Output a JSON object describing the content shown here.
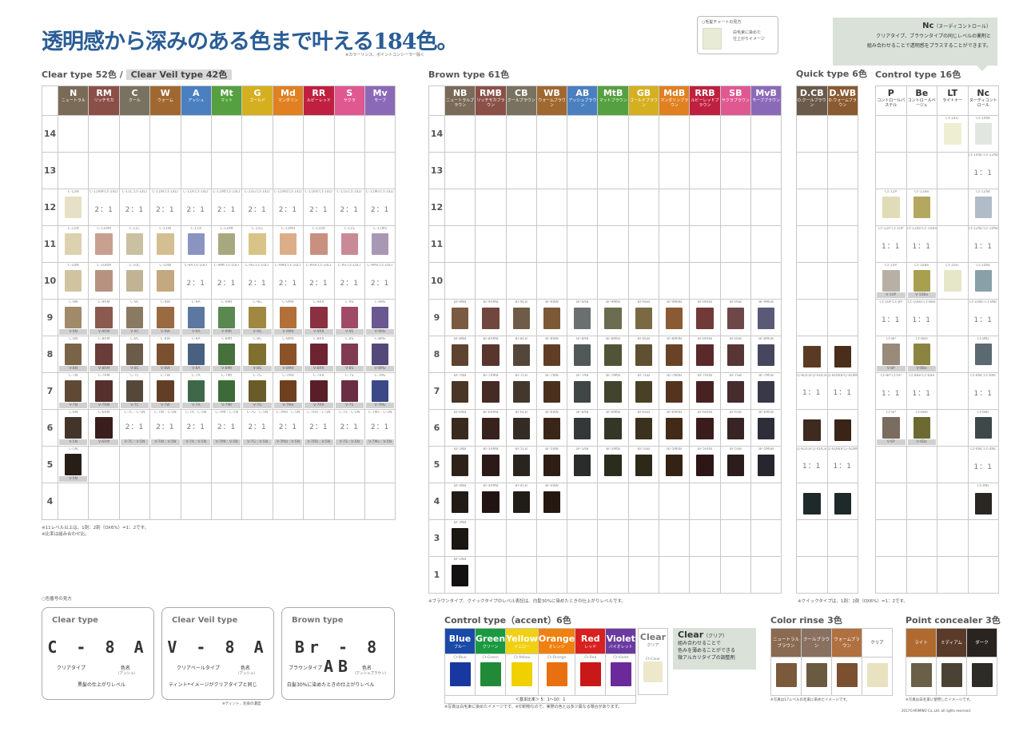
{
  "title": "透明感から深みのある色まで叶える184色。",
  "title_note": "※カラーリンス、ポイントコンシーラー除く",
  "guide": {
    "title": "○毛髪チャートの見方",
    "desc1": "白毛束に染めた",
    "desc2": "仕上がりイメージ"
  },
  "nc_note": {
    "title": "Nc",
    "sub": "（ヌーディコントロール）",
    "line1": "クリアタイプ、ブラウンタイプの同じレベルの薬剤と",
    "line2": "組み合わせることで透明感をプラスすることができます。"
  },
  "clear": {
    "title": "Clear type 52色 /",
    "veil": "Clear Veil type 42色",
    "cols": [
      {
        "n": "N",
        "s": "ニュートラル",
        "c": "#7a6a58"
      },
      {
        "n": "RM",
        "s": "リッチモカ",
        "c": "#8a5048"
      },
      {
        "n": "C",
        "s": "クール",
        "c": "#7a7260"
      },
      {
        "n": "W",
        "s": "ウォーム",
        "c": "#a06830"
      },
      {
        "n": "A",
        "s": "アッシュ",
        "c": "#4a80c0"
      },
      {
        "n": "Mt",
        "s": "マット",
        "c": "#55a040"
      },
      {
        "n": "G",
        "s": "ゴールド",
        "c": "#d4b020"
      },
      {
        "n": "Md",
        "s": "マンダリン",
        "c": "#e08020"
      },
      {
        "n": "RR",
        "s": "ルビーレッド",
        "c": "#c02040"
      },
      {
        "n": "S",
        "s": "サクラ",
        "c": "#e05890"
      },
      {
        "n": "Mv",
        "s": "モーブ",
        "c": "#8a6ab8"
      }
    ],
    "levels": [
      "14",
      "13",
      "12",
      "11",
      "10",
      "9",
      "8",
      "7",
      "6",
      "5",
      "4"
    ],
    "r12": {
      "c": [
        "C-12N",
        "C-11RM:Ct-14LT",
        "C-11C:Ct-14LT",
        "C-11W:Ct-14LT",
        "C-11A:Ct-14LT",
        "C-11Mt:Ct-14LT",
        "C-11G:Ct-14LT",
        "C-11Md:Ct-14LT",
        "C-11RR:Ct-14LT",
        "C-11S:Ct-14LT",
        "C-11Mv:Ct-14LT"
      ],
      "r": "2：1",
      "sw": [
        "#e6e0c6"
      ]
    },
    "r11": {
      "c": [
        "C-11N",
        "C-11RM",
        "C-11C",
        "C-11W",
        "C-11A",
        "C-11Mt",
        "C-11G",
        "C-11Md",
        "C-11RR",
        "C-11S",
        "C-11Mv"
      ],
      "sw": [
        "#dcd2b0",
        "#c8a090",
        "#cac0a2",
        "#d4bf92",
        "#8a94c0",
        "#a8a880",
        "#d8c488",
        "#dcae88",
        "#c89080",
        "#c88a96",
        "#a898b4"
      ]
    },
    "r10": {
      "c": [
        "C-10N",
        "C-10RM",
        "C-10C",
        "C-10W",
        "C-9A:Ct-10LT",
        "C-9Mt:Ct-10LT",
        "C-9G:Ct-10LT",
        "C-9Md:Ct-10LT",
        "C-9RR:Ct-10LT",
        "C-9S:Ct-10LT",
        "C-9Mv:Ct-10LT"
      ],
      "r": "2：1",
      "sw": [
        "#d0c4a0",
        "#b89280",
        "#c0b494",
        "#c4a880"
      ]
    },
    "r9": {
      "c": [
        "C-9N",
        "C-9RM",
        "C-9C",
        "C-9W",
        "C-9A",
        "C-9Mt",
        "C-9G",
        "C-9Md",
        "C-9RR",
        "C-9S",
        "C-9Mv"
      ],
      "v": [
        "V-9N",
        "V-9RM",
        "V-9C",
        "V-9W",
        "V-9A",
        "V-9Mt",
        "V-9G",
        "V-9Md",
        "V-9RR",
        "V-9S",
        "V-9Mv"
      ],
      "sw": [
        "#a08a6a",
        "#8a5a50",
        "#8a7a62",
        "#9a6a40",
        "#5c78a0",
        "#5a8850",
        "#a08840",
        "#b07038",
        "#8a3040",
        "#a04a68",
        "#6a5890"
      ]
    },
    "r8": {
      "c": [
        "C-8N",
        "C-8RM",
        "C-8C",
        "C-8W",
        "C-8A",
        "C-8Mt",
        "C-8G",
        "C-8Md",
        "C-8RR",
        "C-8S",
        "C-8Mv"
      ],
      "v": [
        "V-8N",
        "V-8RM",
        "V-8C",
        "V-8W",
        "V-8A",
        "V-8Mt",
        "V-8G",
        "V-8Md",
        "V-8RR",
        "V-8S",
        "V-8Mv"
      ],
      "sw": [
        "#7a6448",
        "#6a3c38",
        "#6a5c48",
        "#7a5030",
        "#4a6080",
        "#46703c",
        "#807030",
        "#8a5228",
        "#6e2430",
        "#803a52",
        "#544878"
      ]
    },
    "r7": {
      "c": [
        "C-7N",
        "C-7RM",
        "C-7C",
        "C-7W",
        "C-7A",
        "C-7Mt",
        "C-7G",
        "C-7Md",
        "C-7RR",
        "C-7S",
        "C-7Mv"
      ],
      "v": [
        "V-7N",
        "V-7RM",
        "V-7C",
        "V-7W",
        "V-7A",
        "V-7Mt",
        "V-7G",
        "V-7Md",
        "V-7RR",
        "V-7S",
        "V-7Mv"
      ],
      "sw": [
        "#5e4a34",
        "#55302c",
        "#54483a",
        "#623e26",
        "#3e6848",
        "#3c6a38",
        "#6a5c28",
        "#6e4020",
        "#5a1e28",
        "#6a2e44",
        "#3c4888"
      ]
    },
    "r6": {
      "c": [
        "C-6N",
        "C-6RM",
        "C-7C : C-5N",
        "C-7W : C-5N",
        "C-7A : C-5N",
        "C-7Mt : C-5N",
        "C-7G : C-5N",
        "C-7Md : C-5N",
        "C-7RR : C-5N",
        "C-7S : C-5N",
        "C-7Mv : C-5N"
      ],
      "v": [
        "V-5N",
        "V-6RM",
        "V-7C : V-5N",
        "V-7W : V-5N",
        "V-7A : V-5N",
        "V-7Mt : V-5N",
        "V-7G : V-5N",
        "V-7Md : V-5N",
        "V-7RR : V-5N",
        "V-7S : V-5N",
        "V-7Mv : V-5N"
      ],
      "r": "2：1",
      "sw": [
        "#423428",
        "#3a1e1e"
      ]
    },
    "r5": {
      "c": "C-5N",
      "v": "V-5N",
      "sw": "#281e18"
    },
    "note1": "※11レベル以上は、1剤：2剤（OX6%）=1：2です。",
    "note2": "※比率は組み合わせ比。"
  },
  "brown": {
    "title": "Brown type 61色",
    "cols": [
      {
        "n": "NB",
        "s": "ニュートラルブラウン",
        "c": "#7a6a58"
      },
      {
        "n": "RMB",
        "s": "リッチモカブラウン",
        "c": "#8a5048"
      },
      {
        "n": "CB",
        "s": "クールブラウン",
        "c": "#7a7260"
      },
      {
        "n": "WB",
        "s": "ウォームブラウン",
        "c": "#a06830"
      },
      {
        "n": "AB",
        "s": "アッシュブラウン",
        "c": "#4a80c0"
      },
      {
        "n": "MtB",
        "s": "マットブラウン",
        "c": "#55a040"
      },
      {
        "n": "GB",
        "s": "ゴールドブラウン",
        "c": "#d4b020"
      },
      {
        "n": "MdB",
        "s": "マンダリンブラウン",
        "c": "#e08020"
      },
      {
        "n": "RRB",
        "s": "ルビーレッドブラウン",
        "c": "#c02040"
      },
      {
        "n": "SB",
        "s": "サクラブラウン",
        "c": "#e05890"
      },
      {
        "n": "MvB",
        "s": "モーブブラウン",
        "c": "#8a6ab8"
      }
    ],
    "levels": [
      "14",
      "13",
      "12",
      "11",
      "10",
      "9",
      "8",
      "7",
      "6",
      "5",
      "4",
      "3",
      "1"
    ],
    "r9": {
      "c": [
        "Br-9NB",
        "Br-9RMB",
        "Br-9CB",
        "Br-9WB",
        "Br-9AB",
        "Br-9MtB",
        "Br-9GB",
        "Br-9MdB",
        "Br-9RRB",
        "Br-9SB",
        "Br-9MvB"
      ],
      "sw": [
        "#7a5a40",
        "#70473e",
        "#6e5c48",
        "#7c5836",
        "#6a7070",
        "#6c6c50",
        "#7a6a44",
        "#8a5a34",
        "#703a38",
        "#6e4848",
        "#5a5a78"
      ]
    },
    "r8": {
      "c": [
        "Br-8NB",
        "Br-8RMB",
        "Br-8CB",
        "Br-8WB",
        "Br-8AB",
        "Br-8MtB",
        "Br-8GB",
        "Br-8MdB",
        "Br-8RRB",
        "Br-8SB",
        "Br-8MvB"
      ],
      "sw": [
        "#5e4430",
        "#58362e",
        "#54463a",
        "#603e26",
        "#505858",
        "#525438",
        "#5e5030",
        "#6a4226",
        "#5a2a2a",
        "#583636",
        "#46465e"
      ]
    },
    "r7": {
      "c": [
        "Br-7NB",
        "Br-7RMB",
        "Br-7CB",
        "Br-7WB",
        "Br-7AB",
        "Br-7MtB",
        "Br-7GB",
        "Br-7MdB",
        "Br-7RRB",
        "Br-7SB",
        "Br-7MvB"
      ],
      "sw": [
        "#4a3626",
        "#462a24",
        "#42382e",
        "#4c301e",
        "#404646",
        "#42442e",
        "#4a4026",
        "#54341e",
        "#482222",
        "#462c2c",
        "#383848"
      ]
    },
    "r6": {
      "c": [
        "Br-6NB",
        "Br-6RMB",
        "Br-6CB",
        "Br-6WB",
        "Br-6AB",
        "Br-6MtB",
        "Br-6GB",
        "Br-6MdB",
        "Br-6RRB",
        "Br-6SB",
        "Br-6MvB"
      ],
      "sw": [
        "#3a2a1e",
        "#38221e",
        "#342c24",
        "#3a2618",
        "#343838",
        "#343626",
        "#3a321e",
        "#422a18",
        "#3a1c1c",
        "#382424",
        "#2e2e3a"
      ]
    },
    "r5": {
      "c": [
        "Br-5NB",
        "Br-5RMB",
        "Br-5CB",
        "Br-5WB",
        "Br-5AB",
        "Br-5MtB",
        "Br-5GB",
        "Br-5MdB",
        "Br-5RRB",
        "Br-5SB",
        "Br-5MvB"
      ],
      "sw": [
        "#2e2218",
        "#2c1a18",
        "#2a241e",
        "#2e1e14",
        "#2a2c2c",
        "#2a2c1e",
        "#2e2818",
        "#342214",
        "#2e1616",
        "#2c1c1c",
        "#26262e"
      ]
    },
    "r4": {
      "c": [
        "Br-4NB",
        "Br-4RMB",
        "Br-4CB",
        "Br-4WB"
      ],
      "sw": [
        "#221a14",
        "#221412",
        "#201c18",
        "#241810"
      ]
    },
    "r3": {
      "c": "Br-3NB",
      "sw": "#1a1612"
    },
    "r1": {
      "c": "Br-1NB",
      "sw": "#121010"
    },
    "note": "※ブラウンタイプ、クイックタイプのレベル表記は、白髪30%に染めたときの仕上がりレベルです。"
  },
  "quick": {
    "title": "Quick type 6色",
    "cols": [
      {
        "n": "D.CB",
        "s": "D.クールブラウン",
        "c": "#6a5a4a"
      },
      {
        "n": "D.WB",
        "s": "D.ウォームブラウン",
        "c": "#8a5a30"
      }
    ],
    "r8": {
      "sw": [
        "#5a3a22",
        "#4a2e1a"
      ]
    },
    "r7": {
      "c": [
        "Q-8DCB:Q-6DCB",
        "Q-8DWB:Q-6DWB"
      ],
      "r": "1：1"
    },
    "r6": {
      "sw": [
        "#3e2a1e",
        "#3a2418"
      ]
    },
    "r5": {
      "c": [
        "Q-6DCB:Q-4DCB",
        "Q-6DWB:Q-4DWB"
      ],
      "r": "1：1"
    },
    "r4": {
      "sw": [
        "#1e2a2a",
        "#1e2a2a"
      ]
    },
    "note": "※クイックタイプは、1剤：2剤（OX6%）=1：2です。"
  },
  "control": {
    "title": "Control type 16色",
    "cols": [
      {
        "n": "P",
        "s": "コントロールパステル",
        "c": "#fff"
      },
      {
        "n": "Be",
        "s": "コントロールベージュ",
        "c": "#fff"
      },
      {
        "n": "LT",
        "s": "ライトナー",
        "c": "#fff"
      },
      {
        "n": "Nc",
        "s": "ヌーディコントロール",
        "c": "#fff"
      }
    ],
    "r14": {
      "lt": "Ct-14LT",
      "nc": "Ct-14Nc",
      "sw": [
        "#eeeed2",
        "#e2e6e0"
      ]
    },
    "r13": {
      "c": "Ct-14Nc:Ct-12Nc",
      "r": "1：1"
    },
    "r12": {
      "c": [
        "Ct-12P",
        "Ct-12Be",
        "",
        "Ct-12Nc"
      ],
      "sw": [
        "#e0dcb8",
        "#b4a860",
        "#b0bcc8"
      ]
    },
    "r11": {
      "c": [
        "Ct-12P:Ct-10P",
        "Ct-12Be:Ct-10Be",
        "",
        "Ct-12Nc:Ct-10Nc"
      ],
      "r": "1：1"
    },
    "r10": {
      "c": [
        "Ct-10P",
        "Ct-10Be",
        "Ct-10LT",
        "Ct-10Nc"
      ],
      "v": [
        "V-10P",
        "V-10Be"
      ],
      "sw": [
        "#b8b0a4",
        "#a8a050",
        "#e6e6c8",
        "#8aa0a8"
      ]
    },
    "r9": {
      "c": [
        "Ct-10P:Ct-8P",
        "Ct-10Be:Ct-8Be",
        "",
        "Ct-10Nc:Ct-8Nc"
      ],
      "r": "1：1"
    },
    "r8": {
      "c": [
        "Ct-8P",
        "Ct-8Be",
        "",
        "Ct-8Nc"
      ],
      "v": [
        "V-8P",
        "V-8Be"
      ],
      "sw": [
        "#9a8a7a",
        "#8a8440",
        "#5a6a70"
      ]
    },
    "r7": {
      "c": [
        "Ct-8P:Ct-6P",
        "Ct-8Be:Ct-6Be",
        "",
        "Ct-8Nc:Ct-6Nc"
      ],
      "r": "1：1"
    },
    "r6": {
      "c": [
        "Ct-6P",
        "Ct-6Be",
        "",
        "Ct-6Nc"
      ],
      "v": [
        "V-6P",
        "V-6Be"
      ],
      "sw": [
        "#7a6c5e",
        "#6c6a30",
        "#3e4848"
      ]
    },
    "r5": {
      "c": "Ct-6Nc:Ct-4Nc",
      "r": "1：1"
    },
    "r4": {
      "c": "Ct-4Nc",
      "sw": "#2a2622"
    }
  },
  "reading": {
    "title": "○色番号の見方",
    "cards": [
      {
        "t": "Clear type",
        "code": "C - 8 A",
        "l1": "クリアタイプ",
        "l2": "色名",
        "l2s": "（アッシュ）",
        "l3": "黒髪の仕上がりレベル"
      },
      {
        "t": "Clear Veil type",
        "code": "V - 8 A",
        "l1": "クリアベールタイプ",
        "l2": "色名",
        "l2s": "（アッシュ）",
        "l3": "ティント*イメージがクリアタイプと同じ"
      },
      {
        "t": "Brown type",
        "code": "Br - 8 AB",
        "l1": "ブラウンタイプ",
        "l2": "色名",
        "l2s": "（アッシュブラウン）",
        "l3": "白髪30%に染めたときの仕上がりレベル"
      }
    ],
    "tint_note": "※ティント…毛染の濃度"
  },
  "accent": {
    "title": "Control type（accent）6色",
    "cols": [
      {
        "n": "Blue",
        "s": "ブルー",
        "c": "#1a4aa8",
        "sw": "#1838a0",
        "code": "Ct-Blue"
      },
      {
        "n": "Green",
        "s": "グリーン",
        "c": "#1a9a40",
        "sw": "#208a38",
        "code": "Ct-Green"
      },
      {
        "n": "Yellow",
        "s": "イエロー",
        "c": "#f0d010",
        "sw": "#f0d000",
        "code": "Ct-Yellow"
      },
      {
        "n": "Orange",
        "s": "オレンジ",
        "c": "#f08010",
        "sw": "#e87010",
        "code": "Ct-Orange"
      },
      {
        "n": "Red",
        "s": "レッド",
        "c": "#d82020",
        "sw": "#c81818",
        "code": "Ct-Red"
      },
      {
        "n": "Violet",
        "s": "バイオレット",
        "c": "#6a3aa0",
        "sw": "#6a2a9a",
        "code": "Ct-Violet"
      }
    ],
    "ratio": "＜基本比率＞ 5：1〜10：1",
    "clear": {
      "n": "Clear",
      "s": "クリア",
      "code": "Ct-Clear"
    },
    "clear_note": {
      "t": "Clear",
      "ts": "（クリア）",
      "l1": "組み合わせることで",
      "l2": "色みを薄めることができる",
      "l3": "微アルカリタイプの調整剤"
    },
    "note": "※写真は白毛束に染めたイメージです。※印刷物なので、実際の色とは多少異なる場合があります。"
  },
  "rinse": {
    "title": "Color rinse 3色",
    "cols": [
      {
        "s": "ニュートラルブラウン",
        "c": "#8a6a50",
        "sw": "#7a5a3a"
      },
      {
        "s": "クールブラウン",
        "c": "#8a7060",
        "sw": "#6a5a42"
      },
      {
        "s": "ウォームブラウン",
        "c": "#b07040",
        "sw": "#7a5030"
      },
      {
        "s": "クリア",
        "c": "#fff",
        "sw": "#e8e2c0"
      }
    ],
    "note": "※写真は17レベルの毛束に染めたイメージです。"
  },
  "conceal": {
    "title": "Point concealer 3色",
    "cols": [
      {
        "s": "ライト",
        "c": "#b06a30",
        "sw": "#6a6048"
      },
      {
        "s": "ミディアム",
        "c": "#5a3a28",
        "sw": "#4a4234"
      },
      {
        "s": "ダーク",
        "c": "#2a2420",
        "sw": "#2e2c26"
      }
    ],
    "note": "※写真は白毛束に使用したイメージです。"
  },
  "copyright": "2017©ARIMINO Co.,Ltd. all rights reserved."
}
